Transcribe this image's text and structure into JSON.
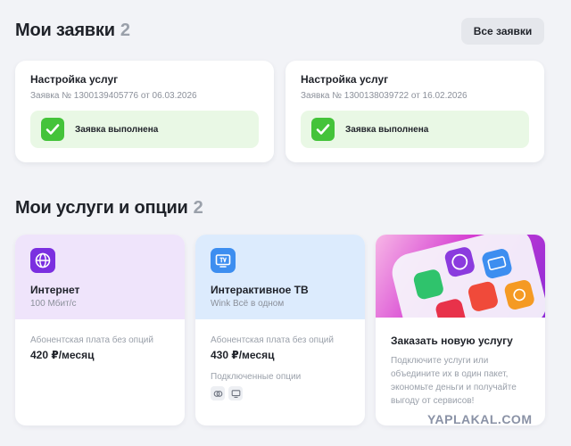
{
  "requests": {
    "title": "Мои заявки",
    "count": "2",
    "all_button": "Все заявки",
    "items": [
      {
        "title": "Настройка услуг",
        "subtitle": "Заявка № 1300139405776 от 06.03.2026",
        "status": "Заявка выполнена"
      },
      {
        "title": "Настройка услуг",
        "subtitle": "Заявка № 1300138039722 от 16.02.2026",
        "status": "Заявка выполнена"
      }
    ]
  },
  "services": {
    "title": "Мои услуги и опции",
    "count": "2",
    "items": [
      {
        "name": "Интернет",
        "desc": "100 Мбит/с",
        "fee_label": "Абонентская плата без опций",
        "fee": "420 ₽/месяц",
        "icon": "globe-icon"
      },
      {
        "name": "Интерактивное ТВ",
        "desc": "Wink Всё в одном",
        "fee_label": "Абонентская плата без опций",
        "fee": "430 ₽/месяц",
        "options_label": "Подключенные опции",
        "icon": "tv-icon",
        "option_icons": [
          "multiscreen-icon",
          "screen-icon"
        ]
      }
    ],
    "promo": {
      "title": "Заказать новую услугу",
      "text": "Подключите услуги или объедините их в один пакет, экономьте деньги и получайте выгоду от сервисов!"
    }
  },
  "colors": {
    "success": "#44c33a",
    "internet_accent": "#7b2fe0",
    "tv_accent": "#3d8ef0"
  },
  "watermark": "YAPLAKAL.COM"
}
